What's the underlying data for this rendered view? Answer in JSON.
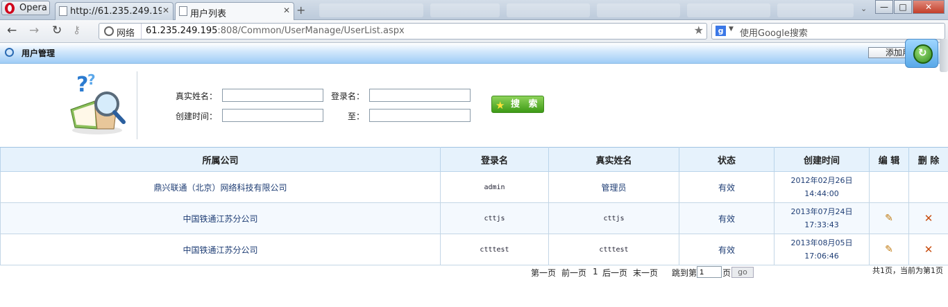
{
  "browser": {
    "opera_label": "Opera",
    "tabs": [
      {
        "title": "http://61.235.249.195..."
      },
      {
        "title": "用户列表"
      }
    ],
    "new_tab": "+",
    "nav_label": "网络",
    "url_host": "61.235.249.195",
    "url_path": ":808/Common/UserManage/UserList.aspx",
    "search_placeholder": "使用Google搜索",
    "window_controls": {
      "minimize": "—",
      "maximize": "□",
      "close": "✕"
    }
  },
  "page": {
    "title": "用户管理",
    "add_button": "添加用户"
  },
  "search": {
    "real_name_label": "真实姓名：",
    "login_name_label": "登录名：",
    "created_label": "创建时间：",
    "to_label": "至：",
    "real_name_value": "",
    "login_name_value": "",
    "created_from_value": "",
    "created_to_value": "",
    "button_label": "搜 索"
  },
  "table": {
    "headers": [
      "所属公司",
      "登录名",
      "真实姓名",
      "状态",
      "创建时间",
      "编 辑",
      "删 除"
    ],
    "rows": [
      {
        "company": "鼎兴联通（北京）网络科技有限公司",
        "login": "admin",
        "name": "管理员",
        "status": "有效",
        "date": "2012年02月26日",
        "time": "14:44:00",
        "editable": false
      },
      {
        "company": "中国铁通江苏分公司",
        "login": "cttjs",
        "name": "cttjs",
        "status": "有效",
        "date": "2013年07月24日",
        "time": "17:33:43",
        "editable": true
      },
      {
        "company": "中国铁通江苏分公司",
        "login": "ctttest",
        "name": "ctttest",
        "status": "有效",
        "date": "2013年08月05日",
        "time": "17:06:46",
        "editable": true
      }
    ]
  },
  "pager": {
    "first": "第一页",
    "prev": "前一页",
    "current": "1",
    "next": "后一页",
    "last": "末一页",
    "jump_prefix": "跳到第",
    "jump_value": "1",
    "jump_suffix": "页",
    "go": "go",
    "summary": "共1页，当前为第1页"
  },
  "icons": {
    "edit": "pencil-icon",
    "delete": "delete-x-icon",
    "search": "star-icon",
    "title": "globe-icon"
  }
}
